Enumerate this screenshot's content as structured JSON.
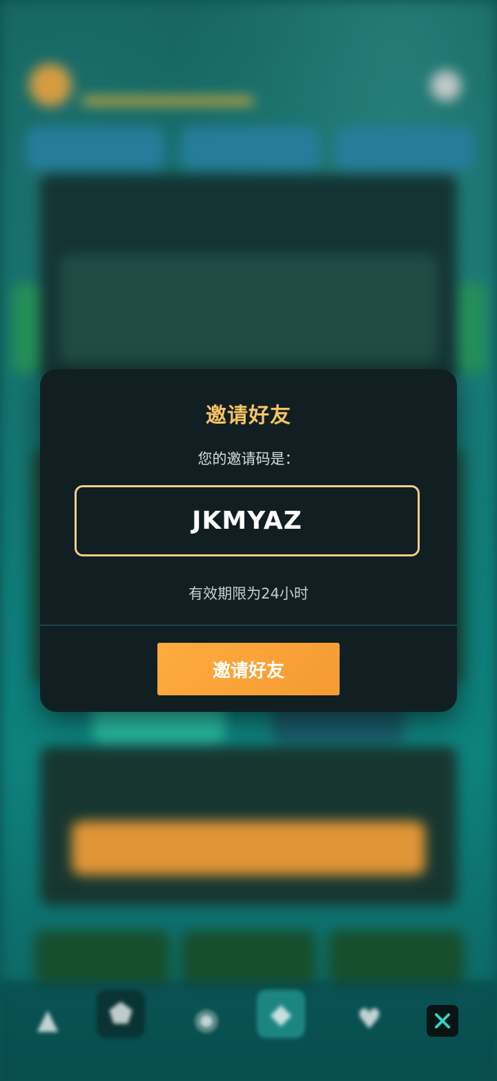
{
  "modal": {
    "title": "邀请好友",
    "subtitle": "您的邀请码是：",
    "invite_code": "JKMYAZ",
    "validity": "有效期限为24小时",
    "button_label": "邀请好友"
  },
  "colors": {
    "title": "#f6c463",
    "code_border": "#f6d08a",
    "button": "#ffab3f",
    "modal_bg": "#121f22",
    "close_icon": "#2fd4c0"
  },
  "icons": {
    "close": "close-icon"
  }
}
